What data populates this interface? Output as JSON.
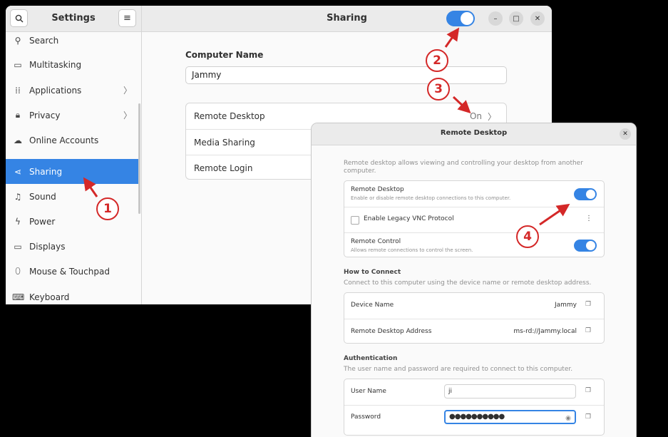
{
  "settings_window": {
    "title": "Settings",
    "panel_title": "Sharing",
    "sharing_switch": "on",
    "sidebar": {
      "items": [
        {
          "label": "Search",
          "icon": "search-icon",
          "chevron": false
        },
        {
          "label": "Multitasking",
          "icon": "multitasking-icon",
          "chevron": false
        },
        {
          "label": "Applications",
          "icon": "applications-icon",
          "chevron": true
        },
        {
          "label": "Privacy",
          "icon": "lock-icon",
          "chevron": true
        },
        {
          "label": "Online Accounts",
          "icon": "cloud-icon",
          "chevron": false
        },
        {
          "label": "Sharing",
          "icon": "share-icon",
          "chevron": false,
          "active": true
        },
        {
          "label": "Sound",
          "icon": "music-note-icon",
          "chevron": false
        },
        {
          "label": "Power",
          "icon": "power-icon",
          "chevron": false
        },
        {
          "label": "Displays",
          "icon": "display-icon",
          "chevron": false
        },
        {
          "label": "Mouse & Touchpad",
          "icon": "mouse-icon",
          "chevron": false
        },
        {
          "label": "Keyboard",
          "icon": "keyboard-icon",
          "chevron": false
        }
      ]
    },
    "computer_name": {
      "label": "Computer Name",
      "value": "Jammy"
    },
    "sharing_list": [
      {
        "label": "Remote Desktop",
        "value": "On"
      },
      {
        "label": "Media Sharing",
        "value": ""
      },
      {
        "label": "Remote Login",
        "value": ""
      }
    ],
    "accent_color": "#3584e4"
  },
  "remote_desktop_dialog": {
    "title": "Remote Desktop",
    "description_line1": "Remote desktop allows viewing and controlling your desktop from another",
    "description_line2": "computer.",
    "remote_desktop": {
      "title": "Remote Desktop",
      "subtitle": "Enable or disable remote desktop connections to this computer.",
      "state": "on"
    },
    "legacy_vnc": {
      "label": "Enable Legacy VNC Protocol",
      "checked": false
    },
    "remote_control": {
      "title": "Remote Control",
      "subtitle": "Allows remote connections to control the screen.",
      "state": "on"
    },
    "how_to_connect": {
      "heading": "How to Connect",
      "description": "Connect to this computer using the device name or remote desktop address.",
      "device_name_label": "Device Name",
      "device_name_value": "Jammy",
      "address_label": "Remote Desktop Address",
      "address_value": "ms-rd://Jammy.local"
    },
    "authentication": {
      "heading": "Authentication",
      "description": "The user name and password are required to connect to this computer.",
      "username_label": "User Name",
      "username_value": "ji",
      "password_label": "Password",
      "password_value": "●●●●●●●●●●"
    }
  },
  "annotations": [
    "1",
    "2",
    "3",
    "4"
  ],
  "annotation_color": "#d42828"
}
